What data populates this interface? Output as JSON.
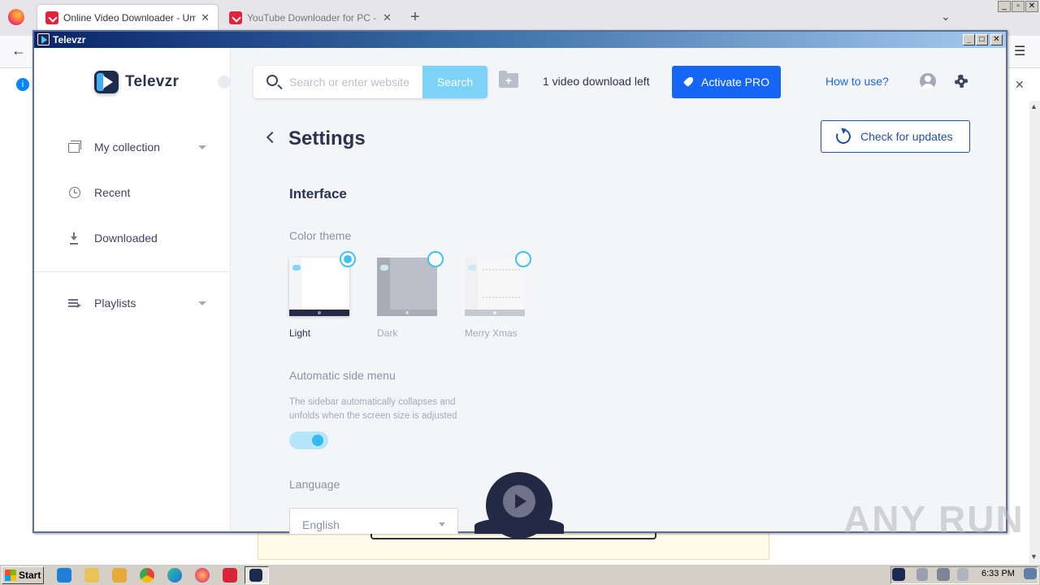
{
  "browser": {
    "tabs": [
      {
        "title": "Online Video Downloader - Ummy",
        "close": "✕"
      },
      {
        "title": "YouTube Downloader for PC - Umm",
        "close": "✕"
      }
    ],
    "new_tab": "+",
    "tabs_chevron": "⌄",
    "back": "←",
    "menu": "☰",
    "info": "i",
    "page_close": "✕",
    "window_controls": [
      "_",
      "▫",
      "✕"
    ]
  },
  "window": {
    "title": "Televzr",
    "controls": [
      "_",
      "□",
      "✕"
    ]
  },
  "sidebar": {
    "logo_text": "Televzr",
    "items": [
      {
        "label": "My collection",
        "icon": "collection-icon",
        "has_caret": true
      },
      {
        "label": "Recent",
        "icon": "history-icon",
        "has_caret": false
      },
      {
        "label": "Downloaded",
        "icon": "download-icon",
        "has_caret": false
      },
      {
        "label": "Playlists",
        "icon": "playlist-icon",
        "has_caret": true
      }
    ]
  },
  "header": {
    "search_placeholder": "Search or enter website",
    "search_button": "Search",
    "downloads_left": "1 video download left",
    "activate_button": "Activate PRO",
    "how_to": "How to use?"
  },
  "settings": {
    "title": "Settings",
    "check_updates": "Check for updates",
    "section_interface": "Interface",
    "color_theme_label": "Color theme",
    "themes": [
      {
        "label": "Light",
        "selected": true
      },
      {
        "label": "Dark",
        "selected": false
      },
      {
        "label": "Merry Xmas",
        "selected": false
      }
    ],
    "auto_menu_label": "Automatic side menu",
    "auto_menu_desc": "The sidebar automatically collapses and unfolds when the screen size is adjusted",
    "auto_menu_enabled": true,
    "language_label": "Language",
    "language_value": "English"
  },
  "watermark": "ANY RUN",
  "taskbar": {
    "start": "Start",
    "time": "6:33 PM"
  },
  "colors": {
    "accent": "#1666f5",
    "radio": "#42c0f0",
    "dark": "#232845"
  }
}
